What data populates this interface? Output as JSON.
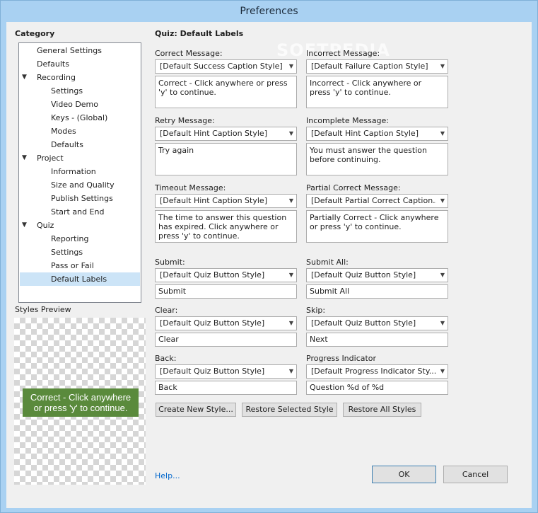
{
  "window": {
    "title": "Preferences"
  },
  "watermark": "SOFTPEDIA",
  "category": {
    "header": "Category",
    "items": [
      {
        "label": "General Settings",
        "indent": 0,
        "expander": ""
      },
      {
        "label": "Defaults",
        "indent": 0,
        "expander": ""
      },
      {
        "label": "Recording",
        "indent": 0,
        "expander": "▼"
      },
      {
        "label": "Settings",
        "indent": 1,
        "expander": ""
      },
      {
        "label": "Video Demo",
        "indent": 1,
        "expander": ""
      },
      {
        "label": "Keys - (Global)",
        "indent": 1,
        "expander": ""
      },
      {
        "label": "Modes",
        "indent": 1,
        "expander": ""
      },
      {
        "label": "Defaults",
        "indent": 1,
        "expander": ""
      },
      {
        "label": "Project",
        "indent": 0,
        "expander": "▼"
      },
      {
        "label": "Information",
        "indent": 1,
        "expander": ""
      },
      {
        "label": "Size and Quality",
        "indent": 1,
        "expander": ""
      },
      {
        "label": "Publish Settings",
        "indent": 1,
        "expander": ""
      },
      {
        "label": "Start and End",
        "indent": 1,
        "expander": ""
      },
      {
        "label": "Quiz",
        "indent": 0,
        "expander": "▼"
      },
      {
        "label": "Reporting",
        "indent": 1,
        "expander": ""
      },
      {
        "label": "Settings",
        "indent": 1,
        "expander": ""
      },
      {
        "label": "Pass or Fail",
        "indent": 1,
        "expander": ""
      },
      {
        "label": "Default Labels",
        "indent": 1,
        "expander": "",
        "selected": true
      }
    ]
  },
  "styles_preview": {
    "label": "Styles Preview",
    "caption_line1": "Correct - Click anywhere",
    "caption_line2": "or press 'y' to continue.",
    "caption_color": "#5a8a3c"
  },
  "panel": {
    "title": "Quiz: Default Labels",
    "correct": {
      "label": "Correct Message:",
      "style": "[Default Success Caption Style]",
      "text": "Correct - Click anywhere or press 'y' to continue."
    },
    "incorrect": {
      "label": "Incorrect Message:",
      "style": "[Default Failure Caption Style]",
      "text": "Incorrect - Click anywhere or press 'y' to continue."
    },
    "retry": {
      "label": "Retry Message:",
      "style": "[Default Hint Caption Style]",
      "text": "Try again"
    },
    "incomplete": {
      "label": "Incomplete Message:",
      "style": "[Default Hint Caption Style]",
      "text": "You must answer the question before continuing."
    },
    "timeout": {
      "label": "Timeout Message:",
      "style": "[Default Hint Caption Style]",
      "text": "The time to answer this question has expired. Click anywhere or press 'y' to continue."
    },
    "partial": {
      "label": "Partial Correct Message:",
      "style": "[Default Partial Correct Caption...",
      "text": "Partially Correct - Click anywhere or press 'y' to continue."
    },
    "submit": {
      "label": "Submit:",
      "style": "[Default Quiz Button Style]",
      "text": "Submit"
    },
    "submit_all": {
      "label": "Submit All:",
      "style": "[Default Quiz Button Style]",
      "text": "Submit All"
    },
    "clear": {
      "label": "Clear:",
      "style": "[Default Quiz Button Style]",
      "text": "Clear"
    },
    "skip": {
      "label": "Skip:",
      "style": "[Default Quiz Button Style]",
      "text": "Next"
    },
    "back": {
      "label": "Back:",
      "style": "[Default Quiz Button Style]",
      "text": "Back"
    },
    "progress": {
      "label": "Progress Indicator",
      "style": "[Default Progress Indicator Sty...",
      "text": "Question %d of %d"
    }
  },
  "buttons": {
    "create_new_style": "Create New Style...",
    "restore_selected_style": "Restore Selected Style",
    "restore_all_styles": "Restore All Styles",
    "help": "Help...",
    "ok": "OK",
    "cancel": "Cancel"
  }
}
